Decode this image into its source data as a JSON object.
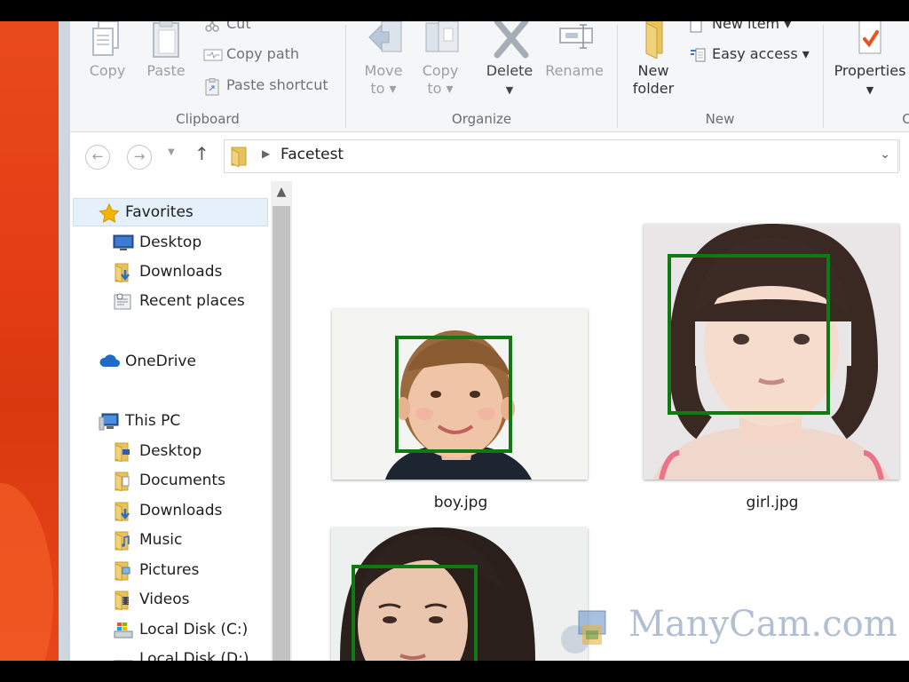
{
  "ribbon": {
    "clipboard": {
      "label": "Clipboard",
      "copy": "Copy",
      "paste": "Paste",
      "cut": "Cut",
      "copy_path": "Copy path",
      "paste_shortcut": "Paste shortcut"
    },
    "organize": {
      "label": "Organize",
      "move_to_1": "Move",
      "move_to_2": "to",
      "copy_to_1": "Copy",
      "copy_to_2": "to",
      "delete": "Delete",
      "rename": "Rename"
    },
    "new": {
      "label": "New",
      "new_folder_1": "New",
      "new_folder_2": "folder",
      "new_item": "New item",
      "easy_access": "Easy access"
    },
    "open": {
      "label": "O",
      "properties": "Properties"
    }
  },
  "address": {
    "path": "Facetest"
  },
  "nav": {
    "favorites": "Favorites",
    "fav_items": [
      "Desktop",
      "Downloads",
      "Recent places"
    ],
    "onedrive": "OneDrive",
    "this_pc": "This PC",
    "pc_items": [
      "Desktop",
      "Documents",
      "Downloads",
      "Music",
      "Pictures",
      "Videos",
      "Local Disk (C:)",
      "Local Disk (D:)"
    ]
  },
  "files": [
    {
      "name": "boy.jpg"
    },
    {
      "name": "girl.jpg"
    },
    {
      "name": ""
    }
  ],
  "watermark": "ManyCam.com",
  "colors": {
    "face_box": "#0f7a13",
    "selection": "#e5f0fb",
    "wallpaper": "#e43d16"
  }
}
